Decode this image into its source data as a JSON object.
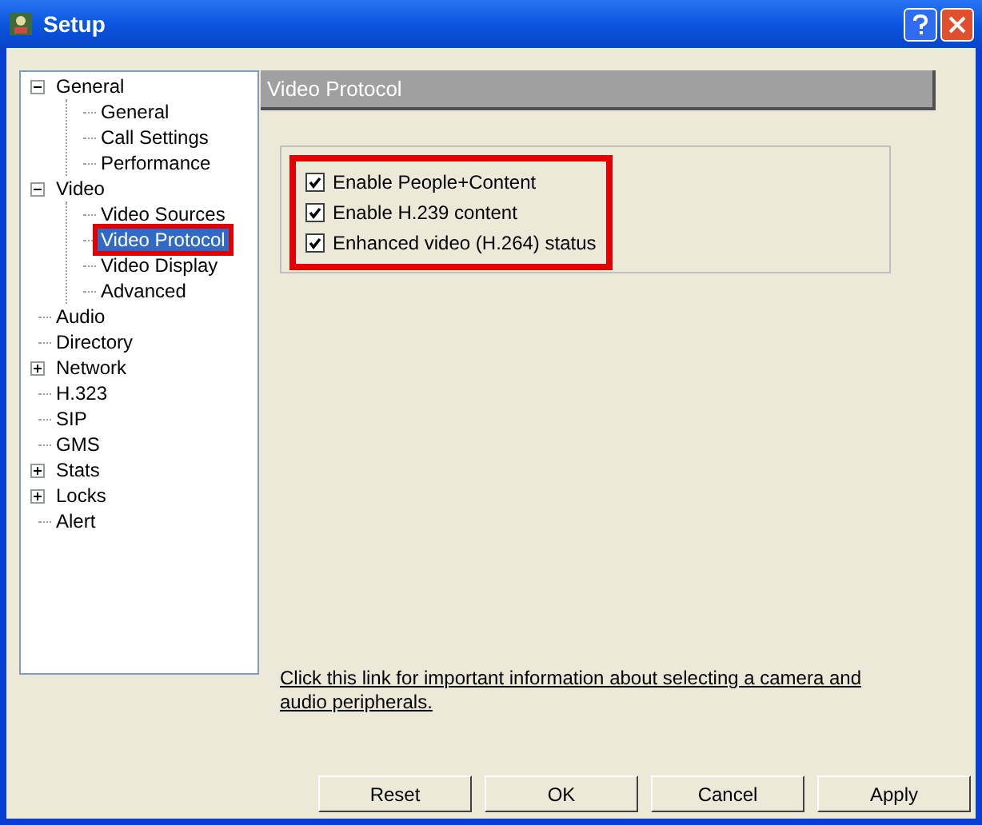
{
  "window": {
    "title": "Setup"
  },
  "tree": [
    {
      "label": "General",
      "selected": false,
      "highlighted": false,
      "expanded": true,
      "children": [
        {
          "label": "General",
          "selected": false,
          "highlighted": false
        },
        {
          "label": "Call Settings",
          "selected": false,
          "highlighted": false
        },
        {
          "label": "Performance",
          "selected": false,
          "highlighted": false
        }
      ]
    },
    {
      "label": "Video",
      "selected": false,
      "highlighted": false,
      "expanded": true,
      "children": [
        {
          "label": "Video Sources",
          "selected": false,
          "highlighted": false
        },
        {
          "label": "Video Protocol",
          "selected": true,
          "highlighted": true
        },
        {
          "label": "Video Display",
          "selected": false,
          "highlighted": false
        },
        {
          "label": "Advanced",
          "selected": false,
          "highlighted": false
        }
      ]
    },
    {
      "label": "Audio",
      "selected": false,
      "highlighted": false
    },
    {
      "label": "Directory",
      "selected": false,
      "highlighted": false
    },
    {
      "label": "Network",
      "selected": false,
      "highlighted": false,
      "expanded": false
    },
    {
      "label": "H.323",
      "selected": false,
      "highlighted": false
    },
    {
      "label": "SIP",
      "selected": false,
      "highlighted": false
    },
    {
      "label": "GMS",
      "selected": false,
      "highlighted": false
    },
    {
      "label": "Stats",
      "selected": false,
      "highlighted": false,
      "expanded": false
    },
    {
      "label": "Locks",
      "selected": false,
      "highlighted": false,
      "expanded": false
    },
    {
      "label": "Alert",
      "selected": false,
      "highlighted": false
    }
  ],
  "panel": {
    "title": "Video Protocol",
    "options_highlighted": true,
    "options": [
      {
        "label": "Enable People+Content",
        "checked": true
      },
      {
        "label": "Enable H.239 content",
        "checked": true
      },
      {
        "label": "Enhanced video (H.264) status",
        "checked": true
      }
    ],
    "link": "Click this link for important information about selecting a camera and audio peripherals."
  },
  "buttons": [
    "Reset",
    "OK",
    "Cancel",
    "Apply"
  ]
}
